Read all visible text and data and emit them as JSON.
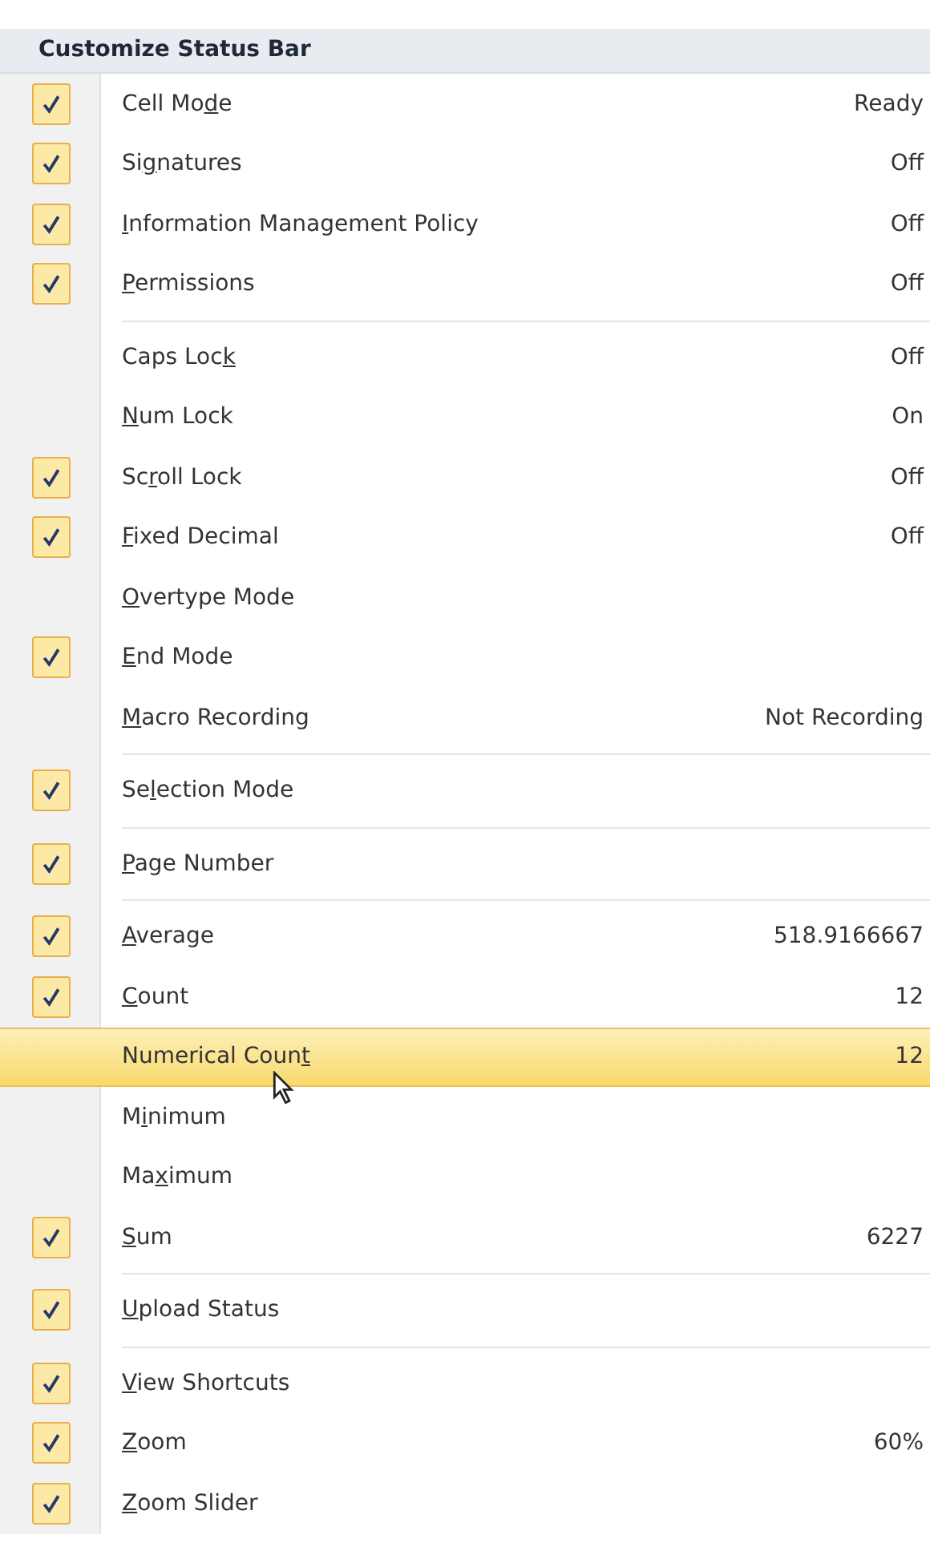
{
  "menu": {
    "title": "Customize Status Bar",
    "groups": [
      {
        "items": [
          {
            "pre": "Cell Mo",
            "key": "d",
            "post": "e",
            "value": "Ready",
            "checked": true,
            "selected": false
          },
          {
            "pre": "Si",
            "key": "g",
            "post": "natures",
            "value": "Off",
            "checked": true,
            "selected": false
          },
          {
            "key": "I",
            "post": "nformation Management Policy",
            "value": "Off",
            "checked": true,
            "selected": false
          },
          {
            "key": "P",
            "post": "ermissions",
            "value": "Off",
            "checked": true,
            "selected": false
          }
        ]
      },
      {
        "items": [
          {
            "pre": "Caps Loc",
            "key": "k",
            "value": "Off",
            "checked": false,
            "selected": false
          },
          {
            "key": "N",
            "post": "um Lock",
            "value": "On",
            "checked": false,
            "selected": false
          },
          {
            "pre": "Sc",
            "key": "r",
            "post": "oll Lock",
            "value": "Off",
            "checked": true,
            "selected": false
          },
          {
            "key": "F",
            "post": "ixed Decimal",
            "value": "Off",
            "checked": true,
            "selected": false
          },
          {
            "key": "O",
            "post": "vertype Mode",
            "checked": false,
            "selected": false
          },
          {
            "key": "E",
            "post": "nd Mode",
            "checked": true,
            "selected": false
          },
          {
            "key": "M",
            "post": "acro Recording",
            "value": "Not Recording",
            "checked": false,
            "selected": false
          }
        ]
      },
      {
        "items": [
          {
            "pre": "Se",
            "key": "l",
            "post": "ection Mode",
            "checked": true,
            "selected": false
          }
        ]
      },
      {
        "items": [
          {
            "key": "P",
            "post": "age Number",
            "checked": true,
            "selected": false
          }
        ]
      },
      {
        "items": [
          {
            "key": "A",
            "post": "verage",
            "value": "518.9166667",
            "checked": true,
            "selected": false
          },
          {
            "key": "C",
            "post": "ount",
            "value": "12",
            "checked": true,
            "selected": false
          },
          {
            "pre": "Numerical Coun",
            "key": "t",
            "value": "12",
            "checked": false,
            "selected": true
          },
          {
            "pre": "M",
            "key": "i",
            "post": "nimum",
            "checked": false,
            "selected": false
          },
          {
            "pre": "Ma",
            "key": "x",
            "post": "imum",
            "checked": false,
            "selected": false
          },
          {
            "key": "S",
            "post": "um",
            "value": "6227",
            "checked": true,
            "selected": false
          }
        ]
      },
      {
        "items": [
          {
            "key": "U",
            "post": "pload Status",
            "checked": true,
            "selected": false
          }
        ]
      },
      {
        "items": [
          {
            "key": "V",
            "post": "iew Shortcuts",
            "checked": true,
            "selected": false
          },
          {
            "key": "Z",
            "post": "oom",
            "value": "60%",
            "checked": true,
            "selected": false
          },
          {
            "key": "Z",
            "post": "oom Slider",
            "checked": true,
            "selected": false
          }
        ]
      }
    ]
  }
}
